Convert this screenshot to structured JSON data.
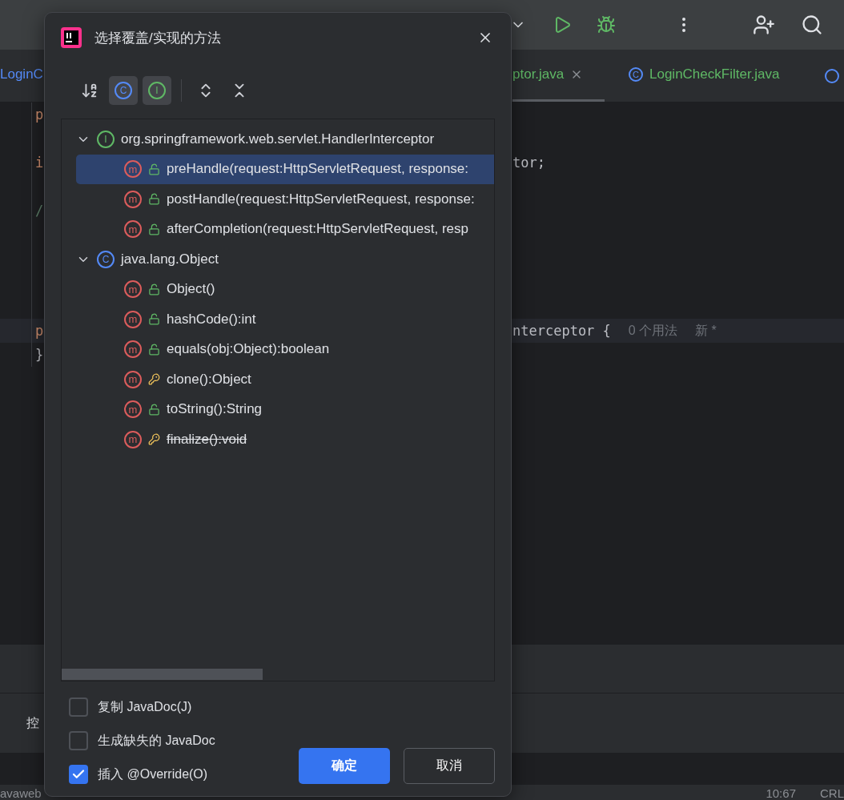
{
  "editor_tabs": [
    {
      "label": "LoginC",
      "selected": false
    },
    {
      "label": "ptor.java",
      "closable": true,
      "selected": true
    },
    {
      "label": "LoginCheckFilter.java",
      "badge": "C",
      "closable": false,
      "selected": false
    }
  ],
  "code_lines": [
    {
      "start": "p",
      "current": false
    },
    {
      "current": false
    },
    {
      "start": "i",
      "end": "tor;",
      "current": false
    },
    {
      "current": false
    },
    {
      "start": "/",
      "current": false
    },
    {
      "current": false
    },
    {
      "current": false
    },
    {
      "current": false
    },
    {
      "current": false
    },
    {
      "start": "p",
      "end": "nterceptor {",
      "hints": [
        "0 个用法",
        "新 *"
      ],
      "current": true
    },
    {
      "start": "}",
      "current": false
    }
  ],
  "bottom_tab": {
    "label": "控"
  },
  "status_bar": {
    "path": "avaweb",
    "position": "10:67",
    "line_ending": "CRL"
  },
  "dialog": {
    "title": "选择覆盖/实现的方法",
    "view_toggles": [
      {
        "kind": "sort",
        "selected": false
      },
      {
        "kind": "classes",
        "badge": "C",
        "selected": true
      },
      {
        "kind": "interfaces",
        "badge": "I",
        "selected": true
      }
    ],
    "tree": [
      {
        "name": "org.springframework.web.servlet.HandlerInterceptor",
        "kind": "interface",
        "badge": "I",
        "expanded": true,
        "children": [
          {
            "label": "preHandle(request:HttpServletRequest, response:",
            "badge": "m",
            "kind": "public",
            "deprecated": false,
            "selected": true
          },
          {
            "label": "postHandle(request:HttpServletRequest, response:",
            "badge": "m",
            "kind": "public",
            "deprecated": false,
            "selected": false
          },
          {
            "label": "afterCompletion(request:HttpServletRequest, resp",
            "badge": "m",
            "kind": "public",
            "deprecated": false,
            "selected": false
          }
        ]
      },
      {
        "name": "java.lang.Object",
        "kind": "class",
        "badge": "C",
        "expanded": true,
        "children": [
          {
            "label": "Object()",
            "badge": "m",
            "kind": "public",
            "deprecated": false,
            "selected": false
          },
          {
            "label": "hashCode():int",
            "badge": "m",
            "kind": "public",
            "deprecated": false,
            "selected": false
          },
          {
            "label": "equals(obj:Object):boolean",
            "badge": "m",
            "kind": "public",
            "deprecated": false,
            "selected": false
          },
          {
            "label": "clone():Object",
            "badge": "m",
            "kind": "protected",
            "deprecated": false,
            "selected": false
          },
          {
            "label": "toString():String",
            "badge": "m",
            "kind": "public",
            "deprecated": false,
            "selected": false
          },
          {
            "label": "finalize():void",
            "badge": "m",
            "kind": "protected",
            "deprecated": true,
            "selected": false
          }
        ]
      }
    ],
    "options": [
      {
        "label": "复制 JavaDoc(J)",
        "checked": false
      },
      {
        "label": "生成缺失的 JavaDoc",
        "checked": false
      },
      {
        "label": "插入 @Override(O)",
        "checked": true
      }
    ],
    "buttons": [
      {
        "label": "确定",
        "kind": "primary"
      },
      {
        "label": "取消",
        "kind": "secondary"
      }
    ]
  }
}
